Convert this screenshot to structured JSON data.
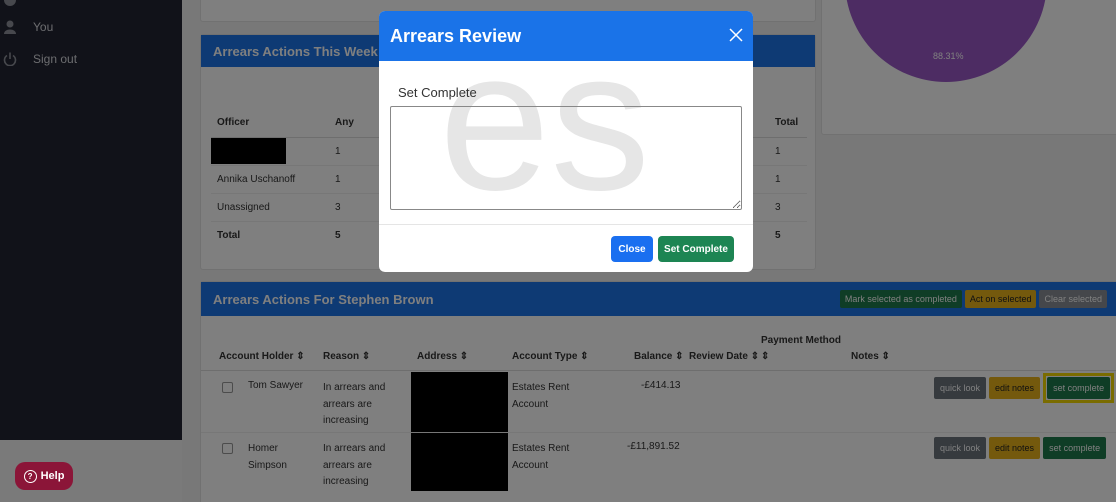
{
  "sidebar": {
    "items": [
      {
        "label": "You",
        "icon": "user-icon"
      },
      {
        "label": "Sign out",
        "icon": "power-icon"
      }
    ]
  },
  "pie": {
    "label": "88.31%",
    "color": "#9b59c7"
  },
  "weekly": {
    "title": "Arrears Actions This Week - For",
    "columns": [
      "Officer",
      "Any",
      "Total"
    ],
    "rows": [
      {
        "officer": "",
        "any": "1",
        "total": "1"
      },
      {
        "officer": "Annika Uschanoff",
        "any": "1",
        "total": "1"
      },
      {
        "officer": "Unassigned",
        "any": "3",
        "total": "3"
      },
      {
        "officer": "Total",
        "any": "5",
        "total": "5"
      }
    ]
  },
  "actions": {
    "title": "Arrears Actions For Stephen Brown",
    "buttons": {
      "mark": "Mark selected as completed",
      "act": "Act on selected",
      "clear": "Clear selected"
    },
    "columns": {
      "holder": "Account Holder ⇕",
      "reason": "Reason ⇕",
      "address": "Address ⇕",
      "type": "Account Type ⇕",
      "balance": "Balance ⇕",
      "review": "Review Date ⇕",
      "payment": "Payment Method",
      "payment_sort": "⇕",
      "notes": "Notes ⇕"
    },
    "rows": [
      {
        "holder": "Tom Sawyer",
        "reason": "In arrears and arrears are increasing",
        "type": "Estates Rent Account",
        "balance": "-£414.13"
      },
      {
        "holder": "Homer Simpson",
        "reason": "In arrears and arrears are increasing",
        "type": "Estates Rent Account",
        "balance": "-£11,891.52"
      }
    ],
    "row_buttons": {
      "quick": "quick look",
      "edit": "edit notes",
      "complete": "set complete"
    }
  },
  "modal": {
    "title": "Arrears Review",
    "field_label": "Set Complete",
    "textarea_value": "",
    "close": "Close",
    "submit": "Set Complete",
    "watermark": "es"
  },
  "help": {
    "label": "Help"
  },
  "colors": {
    "primary": "#1c74e9",
    "success": "#1f7a4d",
    "warning": "#e8b21a",
    "highlight": "#f5d800"
  }
}
